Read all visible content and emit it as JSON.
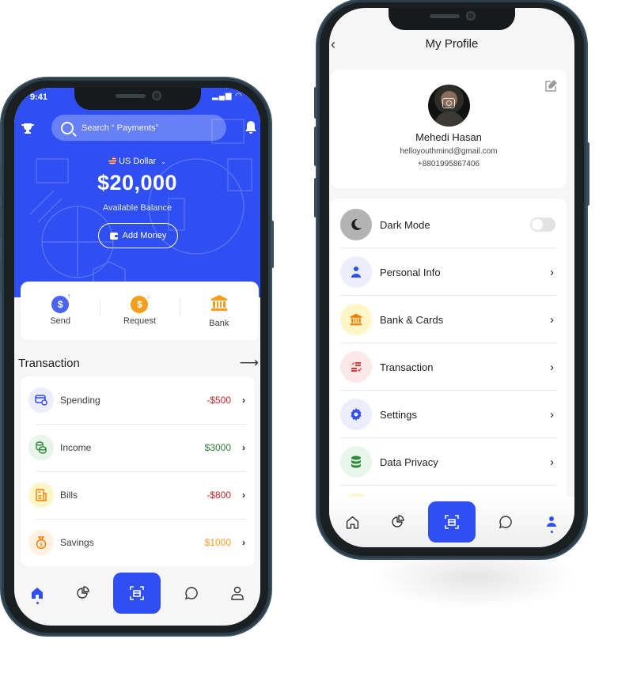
{
  "left_phone": {
    "status": {
      "time": "9:41"
    },
    "header": {
      "trophy_icon": "trophy-icon",
      "search_placeholder": "Search “ Payments”",
      "bell_icon": "bell-icon"
    },
    "balance": {
      "currency": "US Dollar",
      "amount": "$20,000",
      "label": "Available Balance",
      "add_money_label": "Add Money"
    },
    "actions": [
      {
        "label": "Send",
        "icon": "dollar-send-icon",
        "color": "#4a64f0"
      },
      {
        "label": "Request",
        "icon": "dollar-request-icon",
        "color": "#f59e1c"
      },
      {
        "label": "Bank",
        "icon": "bank-icon",
        "color": "#f59e1c"
      }
    ],
    "transactions": {
      "title": "Transaction",
      "items": [
        {
          "name": "Spending",
          "amount": "-$500",
          "amount_color": "#c62828",
          "icon": "card-icon",
          "icon_color": "#2f4ff2",
          "bg": "#eceefd"
        },
        {
          "name": "Income",
          "amount": "$3000",
          "amount_color": "#2e7d32",
          "icon": "coins-icon",
          "icon_color": "#2e8b3a",
          "bg": "#e8f5e9"
        },
        {
          "name": "Bills",
          "amount": "-$800",
          "amount_color": "#c62828",
          "icon": "receipt-icon",
          "icon_color": "#f57c00",
          "bg": "#fff6c8"
        },
        {
          "name": "Savings",
          "amount": "$1000",
          "amount_color": "#f59e1c",
          "icon": "money-bag-icon",
          "icon_color": "#f57c00",
          "bg": "#fff1e0"
        }
      ]
    },
    "tabbar": {
      "active": "home"
    }
  },
  "right_phone": {
    "title": "My Profile",
    "profile": {
      "name": "Mehedi Hasan",
      "email": "helloyouthmind@gmail.com",
      "phone": "+8801995867406"
    },
    "menu": [
      {
        "label": "Dark Mode",
        "icon": "moon-icon",
        "icon_color": "#1f1f1f",
        "bg": "#b3b3b3",
        "control": "toggle",
        "toggle_on": false
      },
      {
        "label": "Personal Info",
        "icon": "user-icon",
        "icon_color": "#2f4ff2",
        "bg": "#eceefd",
        "control": "chevron"
      },
      {
        "label": "Bank & Cards",
        "icon": "bank-icon",
        "icon_color": "#f57c00",
        "bg": "#fff6c8",
        "control": "chevron"
      },
      {
        "label": "Transaction",
        "icon": "transfer-icon",
        "icon_color": "#e53935",
        "bg": "#fde8e8",
        "control": "chevron"
      },
      {
        "label": "Settings",
        "icon": "gear-icon",
        "icon_color": "#2f4ff2",
        "bg": "#eceefd",
        "control": "chevron"
      },
      {
        "label": "Data Privacy",
        "icon": "database-icon",
        "icon_color": "#2e8b3a",
        "bg": "#e8f5e9",
        "control": "chevron"
      }
    ],
    "tabbar": {
      "active": "profile"
    }
  },
  "colors": {
    "primary": "#2f4ff2",
    "background": "#f6f6f6"
  }
}
